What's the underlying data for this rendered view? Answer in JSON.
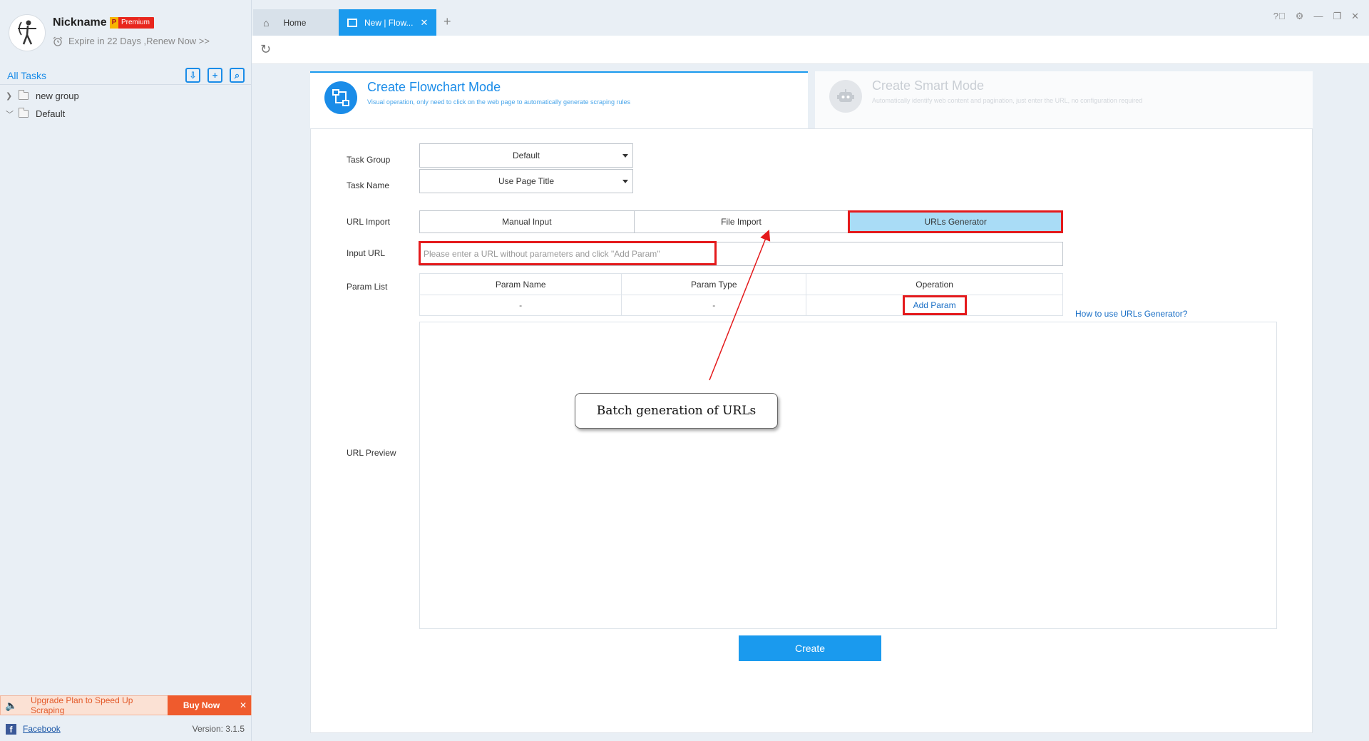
{
  "profile": {
    "nickname": "Nickname",
    "badge_letter": "P",
    "badge_label": "Premium",
    "expire_text": "Expire in 22 Days ,Renew Now >>"
  },
  "sidebar": {
    "all_tasks": "All Tasks",
    "tree": [
      {
        "label": "new group",
        "expanded": false
      },
      {
        "label": "Default",
        "expanded": true
      }
    ],
    "upgrade_text": "Upgrade Plan to Speed Up Scraping",
    "buy_now": "Buy Now",
    "facebook": "Facebook",
    "version": "Version: 3.1.5"
  },
  "tabs": {
    "home": "Home",
    "new": "New | Flow..."
  },
  "modes": {
    "flowchart": {
      "title": "Create Flowchart Mode",
      "subtitle": "Visual operation, only need to click on the web page to automatically generate scraping rules"
    },
    "smart": {
      "title": "Create Smart Mode",
      "subtitle": "Automatically identify web content and pagination, just enter the URL, no configuration required"
    }
  },
  "form": {
    "task_group_label": "Task Group",
    "task_group_value": "Default",
    "task_name_label": "Task Name",
    "task_name_value": "Use Page Title",
    "url_import_label": "URL Import",
    "url_import_options": [
      "Manual Input",
      "File Import",
      "URLs Generator"
    ],
    "url_import_selected": "URLs Generator",
    "input_url_label": "Input URL",
    "input_url_placeholder": "Please enter a URL without parameters and click \"Add Param\"",
    "input_url_value": "",
    "param_list_label": "Param List",
    "param_columns": [
      "Param Name",
      "Param Type",
      "Operation"
    ],
    "param_row": [
      "-",
      "-"
    ],
    "add_param": "Add Param",
    "howto_link": "How to use URLs Generator?",
    "url_preview_label": "URL Preview",
    "create_button": "Create"
  },
  "annotation": {
    "callout_text": "Batch generation of URLs"
  },
  "colors": {
    "accent": "#1a9aee",
    "highlight": "#e41a1c",
    "premium": "#e8261d",
    "upgrade": "#ef5b2d"
  }
}
